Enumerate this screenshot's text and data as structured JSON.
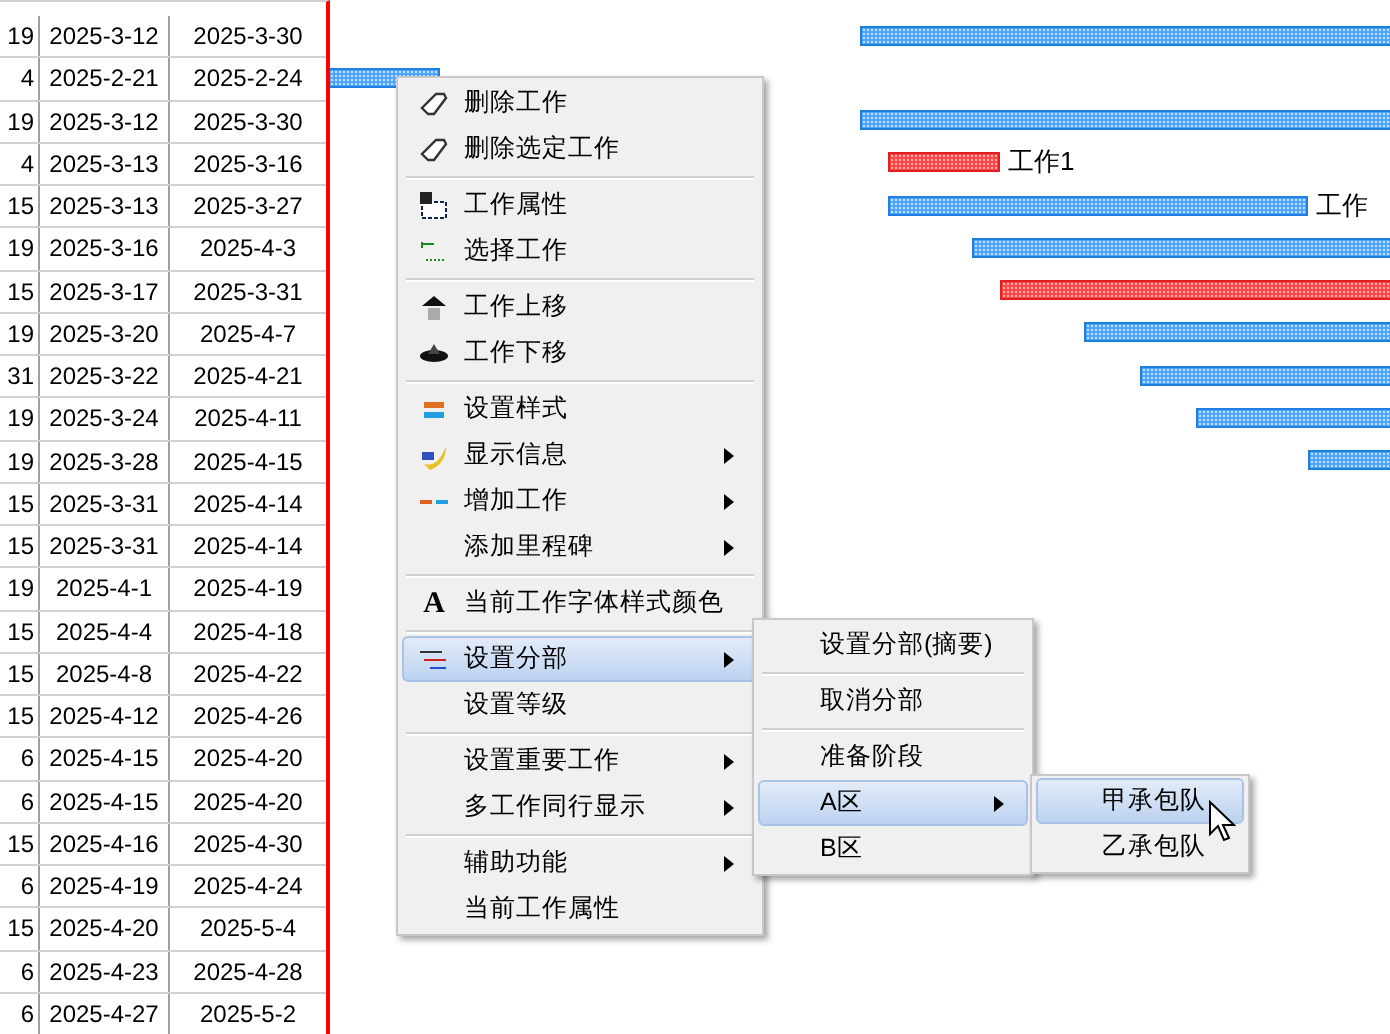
{
  "table": {
    "rows": [
      {
        "duration": "19",
        "start": "2025-3-12",
        "end": "2025-3-30",
        "critical": false
      },
      {
        "duration": "4",
        "start": "2025-2-21",
        "end": "2025-2-24",
        "critical": false
      },
      {
        "duration": "19",
        "start": "2025-3-12",
        "end": "2025-3-30",
        "critical": false
      },
      {
        "duration": "4",
        "start": "2025-3-13",
        "end": "2025-3-16",
        "critical": true,
        "bar_label": "工作1"
      },
      {
        "duration": "15",
        "start": "2025-3-13",
        "end": "2025-3-27",
        "critical": false,
        "bar_label": "工作"
      },
      {
        "duration": "19",
        "start": "2025-3-16",
        "end": "2025-4-3",
        "critical": false
      },
      {
        "duration": "15",
        "start": "2025-3-17",
        "end": "2025-3-31",
        "critical": true
      },
      {
        "duration": "19",
        "start": "2025-3-20",
        "end": "2025-4-7",
        "critical": false
      },
      {
        "duration": "31",
        "start": "2025-3-22",
        "end": "2025-4-21",
        "critical": false
      },
      {
        "duration": "19",
        "start": "2025-3-24",
        "end": "2025-4-11",
        "critical": false
      },
      {
        "duration": "19",
        "start": "2025-3-28",
        "end": "2025-4-15",
        "critical": false
      },
      {
        "duration": "15",
        "start": "2025-3-31",
        "end": "2025-4-14"
      },
      {
        "duration": "15",
        "start": "2025-3-31",
        "end": "2025-4-14"
      },
      {
        "duration": "19",
        "start": "2025-4-1",
        "end": "2025-4-19"
      },
      {
        "duration": "15",
        "start": "2025-4-4",
        "end": "2025-4-18"
      },
      {
        "duration": "15",
        "start": "2025-4-8",
        "end": "2025-4-22"
      },
      {
        "duration": "15",
        "start": "2025-4-12",
        "end": "2025-4-26"
      },
      {
        "duration": "6",
        "start": "2025-4-15",
        "end": "2025-4-20"
      },
      {
        "duration": "6",
        "start": "2025-4-15",
        "end": "2025-4-20"
      },
      {
        "duration": "15",
        "start": "2025-4-16",
        "end": "2025-4-30"
      },
      {
        "duration": "6",
        "start": "2025-4-19",
        "end": "2025-4-24"
      },
      {
        "duration": "15",
        "start": "2025-4-20",
        "end": "2025-5-4"
      },
      {
        "duration": "6",
        "start": "2025-4-23",
        "end": "2025-4-28"
      },
      {
        "duration": "6",
        "start": "2025-4-27",
        "end": "2025-5-2"
      }
    ]
  },
  "context_menu": {
    "items": [
      {
        "kind": "item",
        "label": "删除工作",
        "submenu": false,
        "selected": false
      },
      {
        "kind": "item",
        "label": "删除选定工作",
        "submenu": false,
        "selected": false
      },
      {
        "kind": "separator"
      },
      {
        "kind": "item",
        "label": "工作属性",
        "submenu": false,
        "selected": false
      },
      {
        "kind": "item",
        "label": "选择工作",
        "submenu": false,
        "selected": false
      },
      {
        "kind": "separator"
      },
      {
        "kind": "item",
        "label": "工作上移",
        "submenu": false,
        "selected": false
      },
      {
        "kind": "item",
        "label": "工作下移",
        "submenu": false,
        "selected": false
      },
      {
        "kind": "separator"
      },
      {
        "kind": "item",
        "label": "设置样式",
        "submenu": false,
        "selected": false
      },
      {
        "kind": "item",
        "label": "显示信息",
        "submenu": true,
        "selected": false
      },
      {
        "kind": "item",
        "label": "增加工作",
        "submenu": true,
        "selected": false
      },
      {
        "kind": "item",
        "label": "添加里程碑",
        "submenu": true,
        "selected": false
      },
      {
        "kind": "separator"
      },
      {
        "kind": "item",
        "icon_text": "A",
        "label": "当前工作字体样式颜色",
        "submenu": false,
        "selected": false
      },
      {
        "kind": "separator"
      },
      {
        "kind": "item",
        "label": "设置分部",
        "submenu": true,
        "selected": true
      },
      {
        "kind": "item",
        "label": "设置等级",
        "submenu": false,
        "selected": false
      },
      {
        "kind": "separator"
      },
      {
        "kind": "item",
        "label": "设置重要工作",
        "submenu": true,
        "selected": false
      },
      {
        "kind": "item",
        "label": "多工作同行显示",
        "submenu": true,
        "selected": false
      },
      {
        "kind": "separator"
      },
      {
        "kind": "item",
        "label": "辅助功能",
        "submenu": true,
        "selected": false
      },
      {
        "kind": "item",
        "label": "当前工作属性",
        "submenu": false,
        "selected": false
      }
    ]
  },
  "submenu": {
    "items": [
      {
        "kind": "item",
        "label": "设置分部(摘要)",
        "submenu": false,
        "selected": false
      },
      {
        "kind": "separator"
      },
      {
        "kind": "item",
        "label": "取消分部",
        "submenu": false,
        "selected": false
      },
      {
        "kind": "separator"
      },
      {
        "kind": "item",
        "label": "准备阶段",
        "submenu": false,
        "selected": false
      },
      {
        "kind": "item",
        "label": "A区",
        "submenu": true,
        "selected": true
      },
      {
        "kind": "item",
        "label": "B区",
        "submenu": false,
        "selected": false
      }
    ]
  },
  "sub_submenu": {
    "items": [
      {
        "kind": "item",
        "label": "甲承包队",
        "submenu": false,
        "selected": true
      },
      {
        "kind": "item",
        "label": "乙承包队",
        "submenu": false,
        "selected": false
      }
    ]
  }
}
